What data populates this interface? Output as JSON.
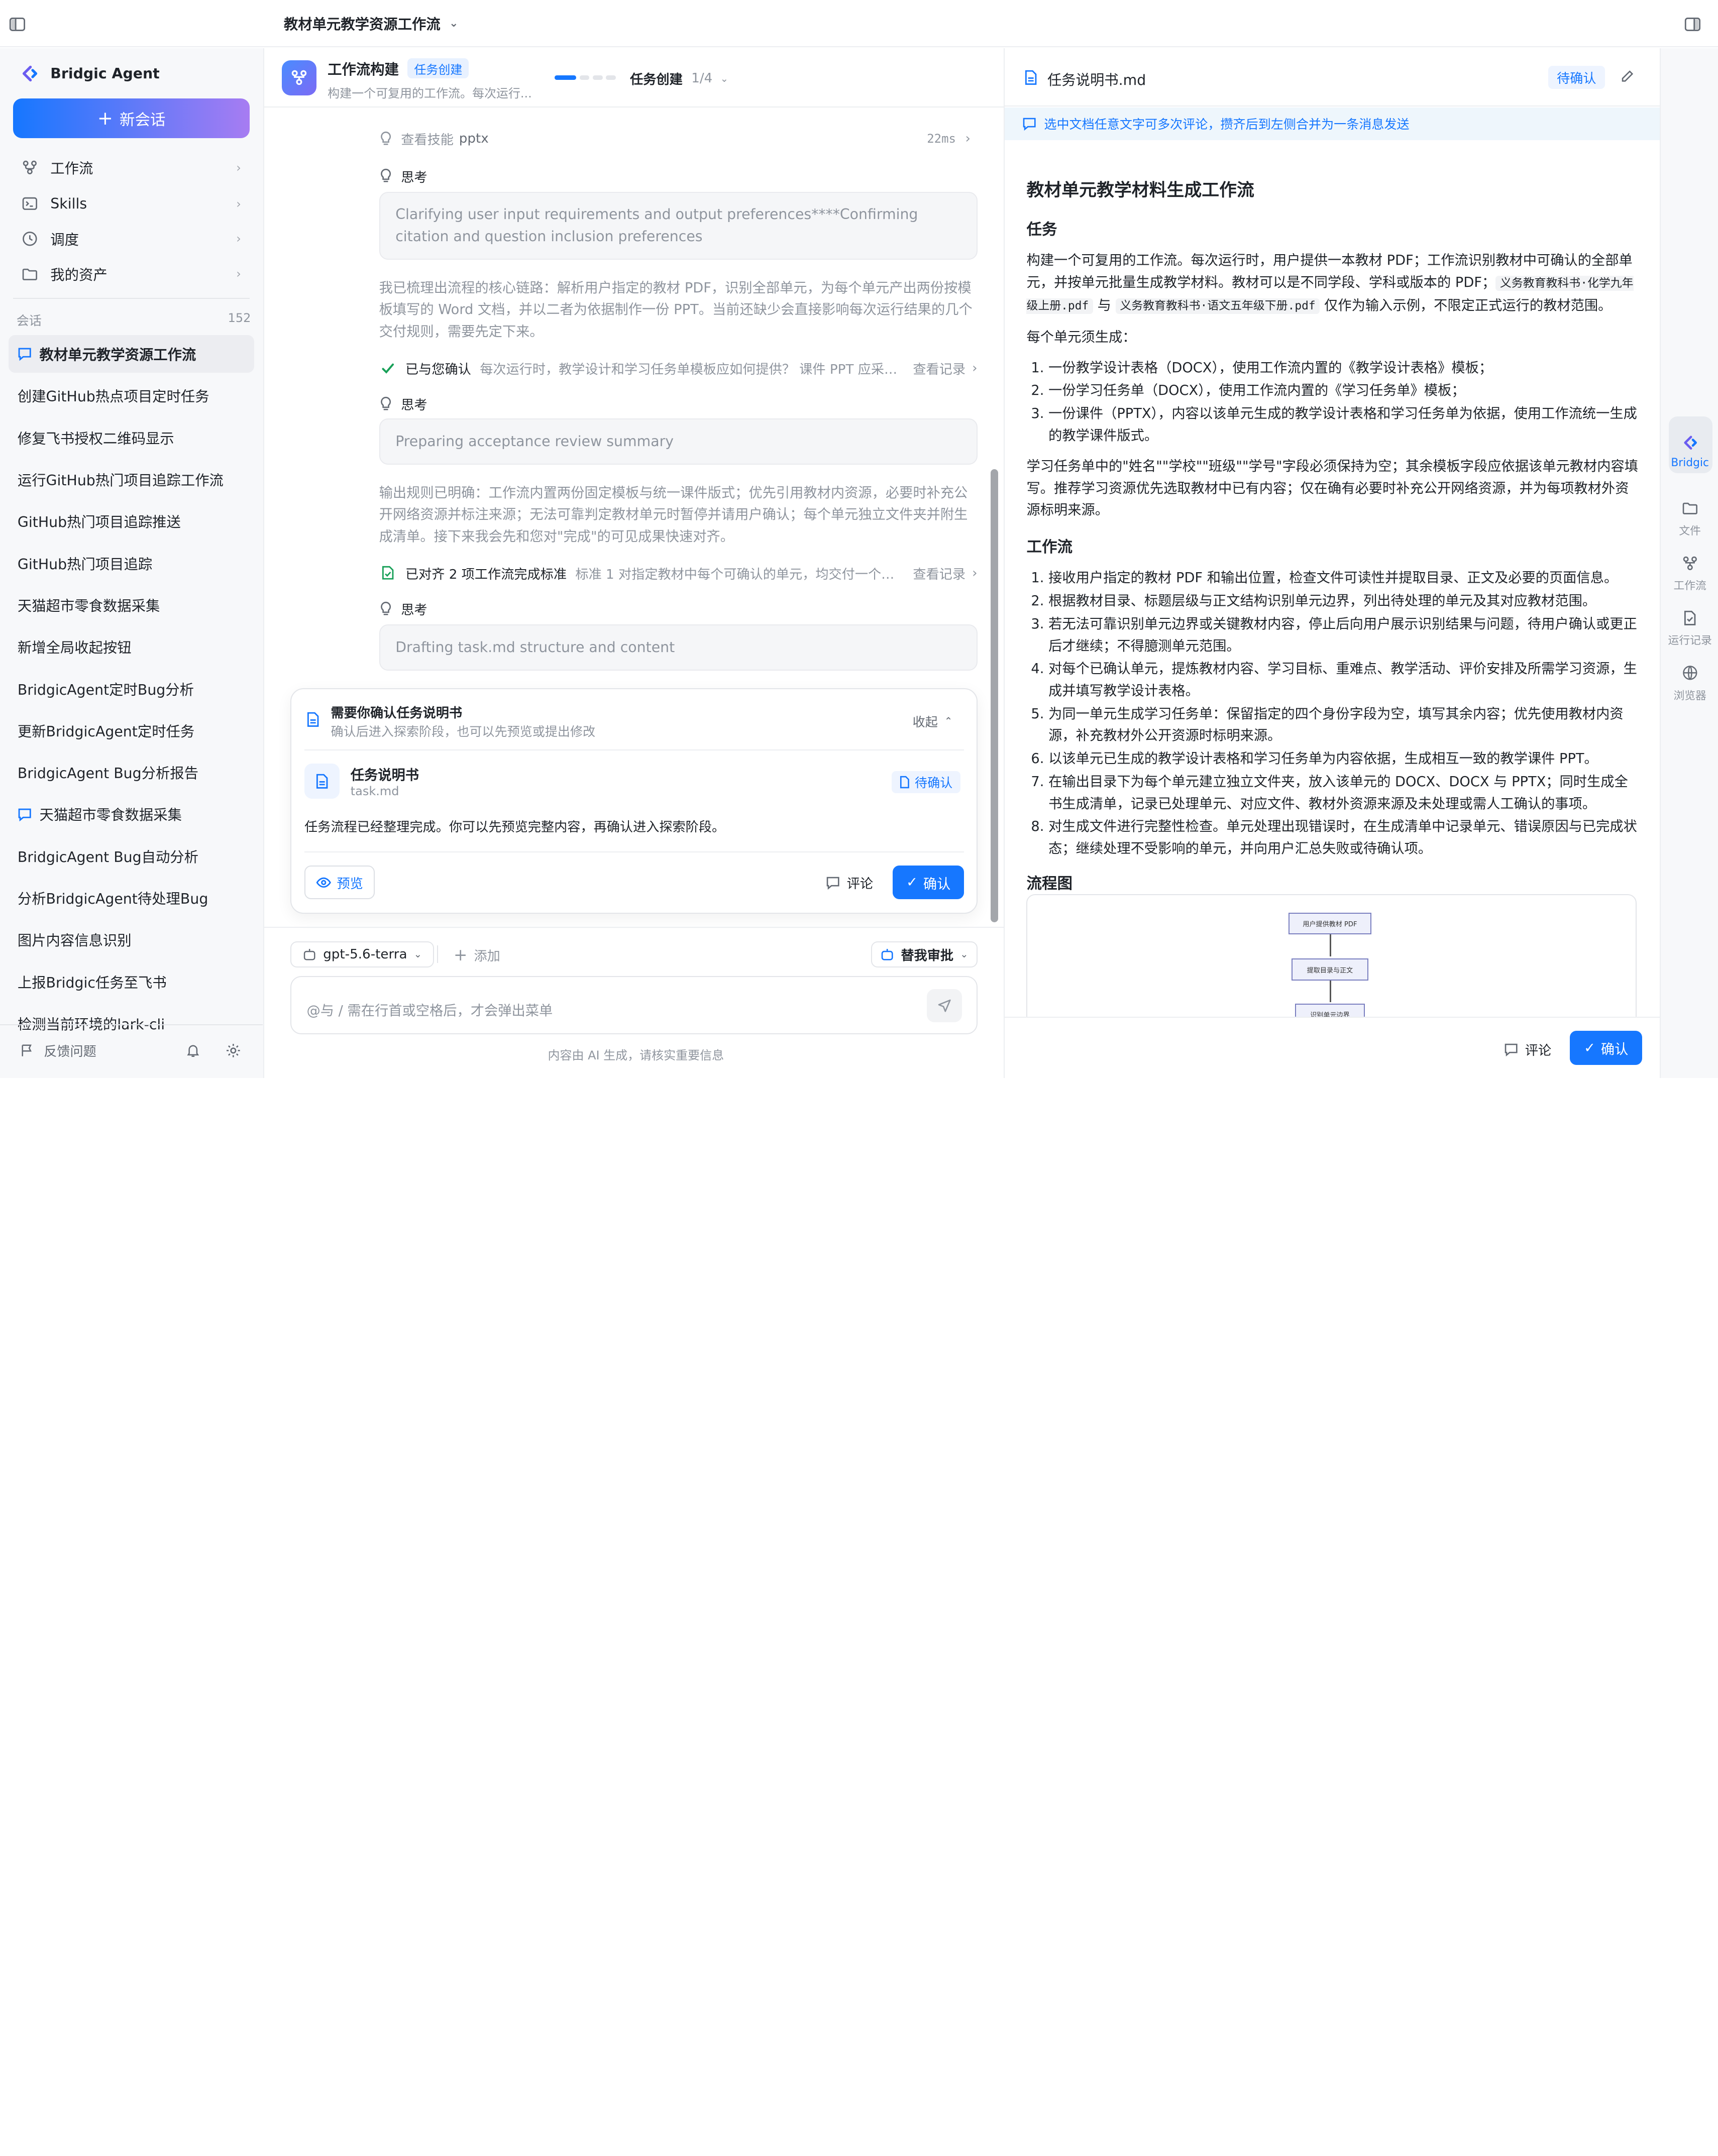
{
  "topbar": {
    "title": "教材单元教学资源工作流"
  },
  "sidebar": {
    "brand": "Bridgic Agent",
    "new_chat": "新会话",
    "nav": [
      {
        "label": "工作流",
        "icon": "workflow-icon"
      },
      {
        "label": "Skills",
        "icon": "terminal-icon"
      },
      {
        "label": "调度",
        "icon": "clock-icon"
      },
      {
        "label": "我的资产",
        "icon": "folder-icon"
      }
    ],
    "sessions_label": "会话",
    "sessions_count": "152",
    "sessions": [
      {
        "label": "教材单元教学资源工作流",
        "active": true,
        "icon": true
      },
      {
        "label": "创建GitHub热点项目定时任务"
      },
      {
        "label": "修复飞书授权二维码显示"
      },
      {
        "label": "运行GitHub热门项目追踪工作流"
      },
      {
        "label": "GitHub热门项目追踪推送"
      },
      {
        "label": "GitHub热门项目追踪"
      },
      {
        "label": "天猫超市零食数据采集"
      },
      {
        "label": "新增全局收起按钮"
      },
      {
        "label": "BridgicAgent定时Bug分析"
      },
      {
        "label": "更新BridgicAgent定时任务"
      },
      {
        "label": "BridgicAgent Bug分析报告"
      },
      {
        "label": "天猫超市零食数据采集",
        "icon": true
      },
      {
        "label": "BridgicAgent Bug自动分析"
      },
      {
        "label": "分析BridgicAgent待处理Bug"
      },
      {
        "label": "图片内容信息识别"
      },
      {
        "label": "上报Bridgic任务至飞书"
      },
      {
        "label": "检测当前环境的lark-cli"
      }
    ],
    "feedback": "反馈问题"
  },
  "center": {
    "header": {
      "title": "工作流构建",
      "badge": "任务创建",
      "subtitle": "构建一个可复用的工作流。每次运行...",
      "progress": 0.25,
      "stage": "任务创建",
      "stage_count": "1/4"
    },
    "steps": {
      "skill_label": "查看技能",
      "skill_name": "pptx",
      "skill_time": "22ms",
      "think_label": "思考",
      "think1": "Clarifying user input requirements and output preferences****Confirming citation and question inclusion preferences",
      "para1": "我已梳理出流程的核心链路：解析用户指定的教材 PDF，识别全部单元，为每个单元产出两份按模板填写的 Word 文档，并以二者为依据制作一份 PPT。当前还缺少会直接影响每次运行结果的几个交付规则，需要先定下来。",
      "rec1_title": "已与您确认",
      "rec1_desc": "每次运行时，教学设计和学习任务单模板应如何提供？ 课件 PPT 应采用哪种版...",
      "rec_link": "查看记录",
      "think2": "Preparing acceptance review summary",
      "para2": "输出规则已明确：工作流内置两份固定模板与统一课件版式；优先引用教材内资源，必要时补充公开网络资源并标注来源；无法可靠判定教材单元时暂停并请用户确认；每个单元独立文件夹并附生成清单。接下来我会先和您对\"完成\"的可见成果快速对齐。",
      "rec2_title": "已对齐 2 项工作流完成标准",
      "rec2_desc": "标准 1 对指定教材中每个可确认的单元，均交付一个独立文件...",
      "think3": "Drafting task.md structure and content"
    },
    "card": {
      "title": "需要你确认任务说明书",
      "subtitle": "确认后进入探索阶段，也可以先预览或提出修改",
      "collapse": "收起",
      "file_title": "任务说明书",
      "file_name": "task.md",
      "status": "待确认",
      "message": "任务流程已经整理完成。你可以先预览完整内容，再确认进入探索阶段。",
      "preview": "预览",
      "comment": "评论",
      "confirm": "确认"
    },
    "composer": {
      "model": "gpt-5.6-terra",
      "add": "添加",
      "approve": "替我审批",
      "placeholder": "@与 / 需在行首或空格后，才会弹出菜单",
      "disclaimer": "内容由 AI 生成，请核实重要信息"
    }
  },
  "doc": {
    "filename": "任务说明书.md",
    "status": "待确认",
    "hint": "选中文档任意文字可多次评论，攒齐后到左侧合并为一条消息发送",
    "h1": "教材单元教学材料生成工作流",
    "h_task": "任务",
    "task_p1a": "构建一个可复用的工作流。每次运行时，用户提供一本教材 PDF；工作流识别教材中可确认的全部单元，并按单元批量生成教学材料。教材可以是不同学段、学科或版本的 PDF；",
    "code1": "义务教育教科书·化学九年级上册.pdf",
    "task_p1b": " 与 ",
    "code2": "义务教育教科书·语文五年级下册.pdf",
    "task_p1c": " 仅作为输入示例，不限定正式运行的教材范围。",
    "task_p2": "每个单元须生成：",
    "task_list": [
      "一份教学设计表格（DOCX），使用工作流内置的《教学设计表格》模板；",
      "一份学习任务单（DOCX），使用工作流内置的《学习任务单》模板；",
      "一份课件（PPTX），内容以该单元生成的教学设计表格和学习任务单为依据，使用工作流统一生成的教学课件版式。"
    ],
    "task_p3": "学习任务单中的\"姓名\"\"学校\"\"班级\"\"学号\"字段必须保持为空；其余模板字段应依据该单元教材内容填写。推荐学习资源优先选取教材中已有内容；仅在确有必要时补充公开网络资源，并为每项教材外资源标明来源。",
    "h_flow": "工作流",
    "flow_list": [
      "接收用户指定的教材 PDF 和输出位置，检查文件可读性并提取目录、正文及必要的页面信息。",
      "根据教材目录、标题层级与正文结构识别单元边界，列出待处理的单元及其对应教材范围。",
      "若无法可靠识别单元边界或关键教材内容，停止后向用户展示识别结果与问题，待用户确认或更正后才继续；不得臆测单元范围。",
      "对每个已确认单元，提炼教材内容、学习目标、重难点、教学活动、评价安排及所需学习资源，生成并填写教学设计表格。",
      "为同一单元生成学习任务单：保留指定的四个身份字段为空，填写其余内容；优先使用教材内资源，补充教材外公开资源时标明来源。",
      "以该单元已生成的教学设计表格和学习任务单为内容依据，生成相互一致的教学课件 PPT。",
      "在输出目录下为每个单元建立独立文件夹，放入该单元的 DOCX、DOCX 与 PPTX；同时生成全书生成清单，记录已处理单元、对应文件、教材外资源来源及未处理或需人工确认的事项。",
      "对生成文件进行完整性检查。单元处理出现错误时，在生成清单中记录单元、错误原因与已完成状态；继续处理不受影响的单元，并向用户汇总失败或待确认项。"
    ],
    "h_chart": "流程图",
    "flow_nodes": [
      "用户提供教材 PDF",
      "提取目录与正文",
      "识别单元边界"
    ],
    "comment": "评论",
    "confirm": "确认"
  },
  "rail": {
    "items": [
      {
        "label": "Bridgic",
        "icon": "bridgic-logo-icon",
        "active": true
      },
      {
        "label": "文件",
        "icon": "folder-icon"
      },
      {
        "label": "工作流",
        "icon": "workflow-icon"
      },
      {
        "label": "运行记录",
        "icon": "record-icon"
      },
      {
        "label": "浏览器",
        "icon": "globe-icon"
      }
    ]
  },
  "colors": {
    "accent": "#1677ff",
    "accent_grad_end": "#a77cf2",
    "pending": "#1677ff",
    "success": "#18a058"
  }
}
